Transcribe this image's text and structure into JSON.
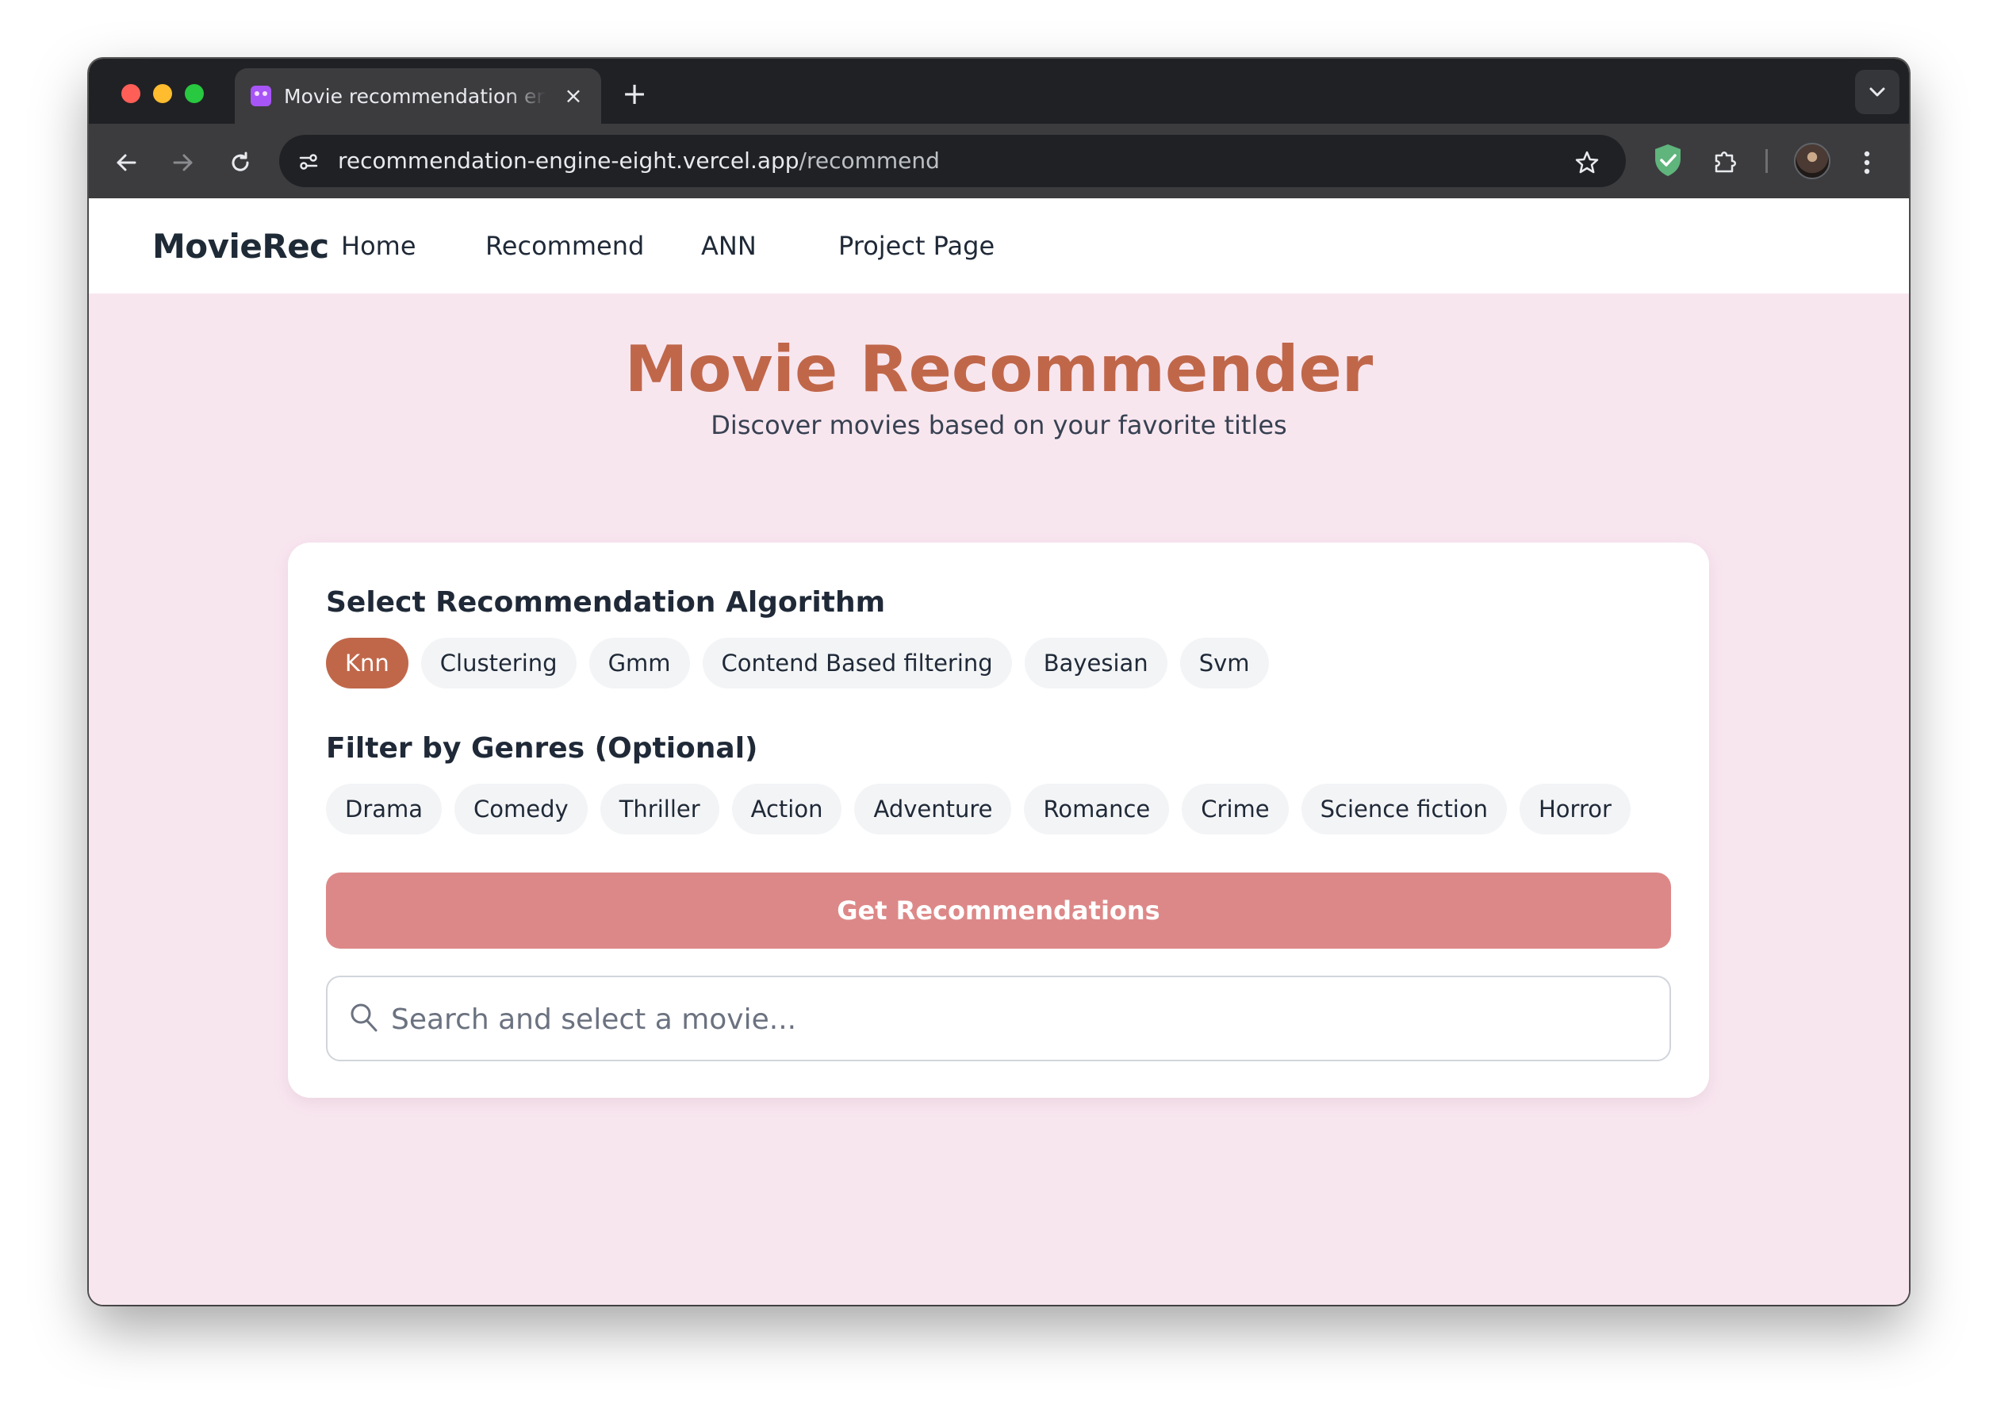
{
  "browser": {
    "tab_title": "Movie recommendation engine",
    "tab_close": "×",
    "new_tab": "+",
    "url_host": "recommendation-engine-eight.vercel.app",
    "url_path": "/recommend",
    "icons": {
      "back": "arrow-left-icon",
      "forward": "arrow-right-icon",
      "reload": "reload-icon",
      "site_info": "tune-icon",
      "bookmark": "star-icon",
      "extension_shield": "shield-check-icon",
      "extensions": "puzzle-icon",
      "profile": "avatar",
      "menu": "kebab-menu-icon",
      "tabs_menu": "chevron-down-icon"
    },
    "colors": {
      "tab_bg": "#202124",
      "toolbar_bg": "#3c3c3f",
      "omnibox_bg": "#202124",
      "shield": "#5fb57c"
    }
  },
  "site_nav": {
    "brand": "MovieRec",
    "links": [
      "Home",
      "Recommend",
      "ANN",
      "Project Page"
    ]
  },
  "hero": {
    "title": "Movie Recommender",
    "subtitle": "Discover movies based on your favorite titles"
  },
  "algorithm": {
    "heading": "Select Recommendation Algorithm",
    "options": [
      "Knn",
      "Clustering",
      "Gmm",
      "Contend Based filtering",
      "Bayesian",
      "Svm"
    ],
    "selected": "Knn"
  },
  "genres": {
    "heading": "Filter by Genres (Optional)",
    "options": [
      "Drama",
      "Comedy",
      "Thriller",
      "Action",
      "Adventure",
      "Romance",
      "Crime",
      "Science fiction",
      "Horror"
    ]
  },
  "actions": {
    "submit_label": "Get Recommendations"
  },
  "search": {
    "placeholder": "Search and select a movie...",
    "value": ""
  },
  "colors": {
    "page_bg": "#f8e6ef",
    "accent": "#c0674a",
    "button": "#dd8888",
    "chip_bg": "#f3f4f6",
    "text": "#1f2937"
  }
}
